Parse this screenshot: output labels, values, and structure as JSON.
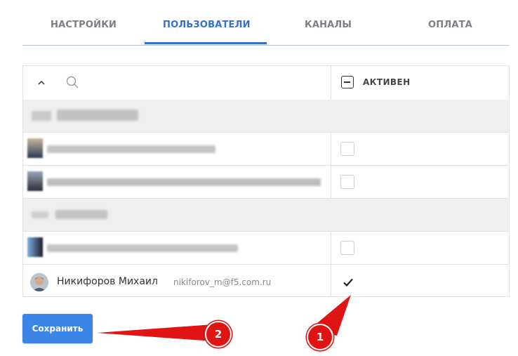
{
  "tabs": [
    {
      "label": "НАСТРОЙКИ"
    },
    {
      "label": "ПОЛЬЗОВАТЕЛИ"
    },
    {
      "label": "КАНАЛЫ"
    },
    {
      "label": "ОПЛАТА"
    }
  ],
  "active_tab": "ПОЛЬЗОВАТЕЛИ",
  "table": {
    "column_label": "АКТИВЕН",
    "user": {
      "name": "Никифоров Михаил",
      "email": "nikiforov_m@f5.com.ru",
      "active": true
    }
  },
  "save_label": "Сохранить",
  "annotations": [
    {
      "label": "1"
    },
    {
      "label": "2"
    }
  ],
  "colors": {
    "accent": "#2f6fd6",
    "button": "#3d86e8",
    "annotation": "#e11414",
    "group_row": "#efefef"
  }
}
